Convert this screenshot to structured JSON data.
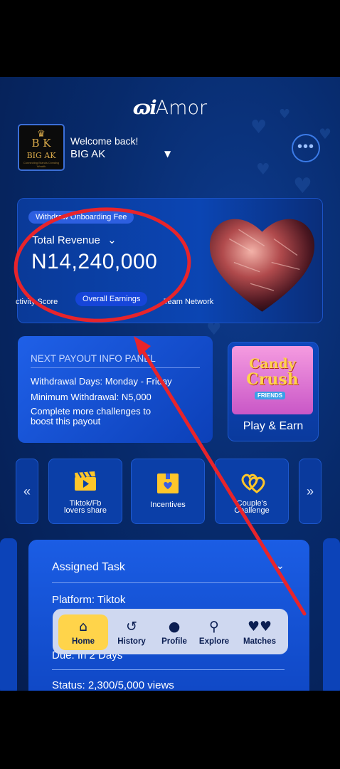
{
  "app": {
    "logo_mark": "ɷi",
    "logo_word": "Amor"
  },
  "profile": {
    "avatar_crown": "♛",
    "avatar_monogram": "B K",
    "avatar_name": "BIG AK",
    "avatar_tagline": "Connecting Brands Creating Wealth",
    "welcome": "Welcome back!",
    "username": "BIG AK",
    "caret": "▼",
    "menu": "•••"
  },
  "revenue": {
    "fee_button": "Withdraw Onboarding Fee",
    "label": "Total Revenue",
    "label_chevron": "⌄",
    "amount": "N14,240,000",
    "tabs": [
      "ctivity Score",
      "Overall Earnings",
      "Team Network"
    ]
  },
  "payout": {
    "title": "NEXT PAYOUT INFO PANEL",
    "withdrawal_days": "Withdrawal Days: Monday - Friday",
    "minimum": "Minimum Withdrawal: N5,000",
    "note_line1": "Complete more challenges to",
    "note_line2": "boost this payout"
  },
  "game": {
    "title_line1": "Candy",
    "title_line2": "Crush",
    "badge": "FRIENDS",
    "label": "Play & Earn"
  },
  "quick_actions": {
    "prev": "«",
    "next": "»",
    "items": [
      {
        "icon": "clapperboard-icon",
        "label_line1": "Tiktok/Fb",
        "label_line2": "lovers share"
      },
      {
        "icon": "gift-box-icon",
        "label_line1": "Incentives",
        "label_line2": ""
      },
      {
        "icon": "linked-hearts-icon",
        "label_line1": "Couple's",
        "label_line2": "Challenge"
      }
    ]
  },
  "task": {
    "title": "Assigned Task",
    "chevron": "⌄",
    "platform": "Platform: Tiktok",
    "due": "Due: In 2 Days",
    "status": "Status: 2,300/5,000 views"
  },
  "bottom_nav": {
    "items": [
      {
        "label": "Home",
        "icon": "⌂"
      },
      {
        "label": "History",
        "icon": "↺"
      },
      {
        "label": "Profile",
        "icon": "●"
      },
      {
        "label": "Explore",
        "icon": "⚲"
      },
      {
        "label": "Matches",
        "icon": "♥♥"
      }
    ],
    "active": "Home"
  },
  "colors": {
    "background": "#072a6b",
    "accent_active": "#ffd44a",
    "annotation_red": "#e8242b"
  }
}
